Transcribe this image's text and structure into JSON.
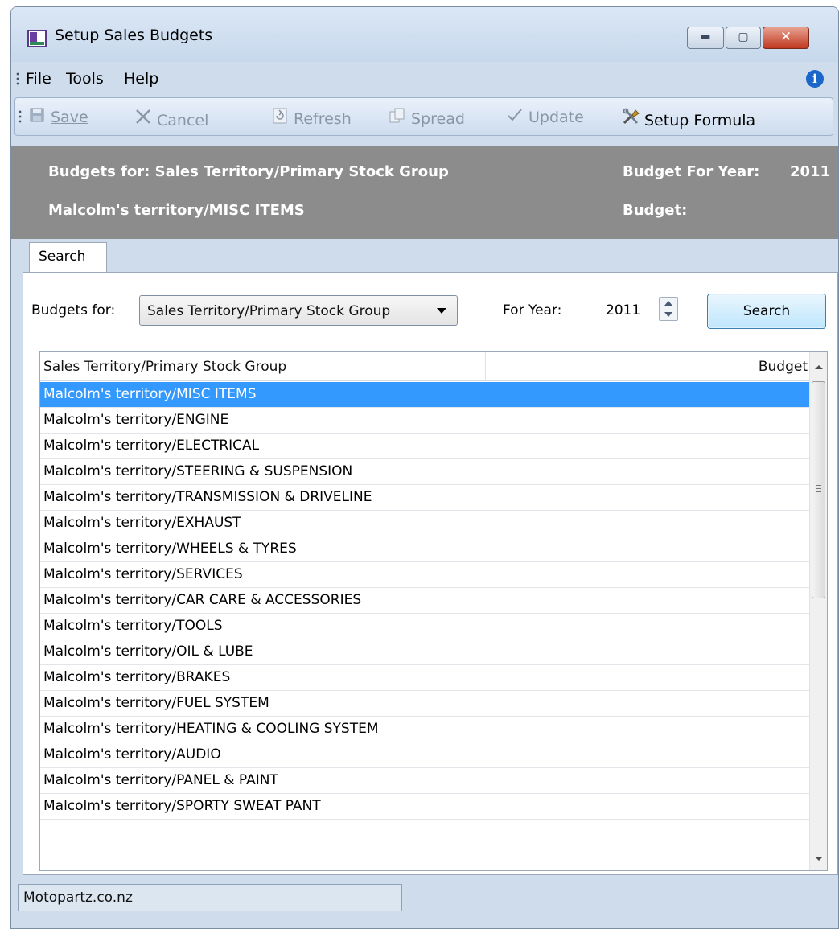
{
  "window": {
    "title": "Setup Sales Budgets",
    "minimize_label": "▬",
    "maximize_label": "▢",
    "close_label": "✕"
  },
  "menu": {
    "items": [
      {
        "label": "File"
      },
      {
        "label": "Tools"
      },
      {
        "label": "Help"
      }
    ],
    "info_glyph": "i"
  },
  "toolbar": {
    "save": {
      "label": "Save",
      "icon": "save-icon",
      "enabled": false
    },
    "cancel": {
      "label": "Cancel",
      "icon": "cancel-icon",
      "enabled": false
    },
    "refresh": {
      "label": "Refresh",
      "icon": "refresh-icon",
      "enabled": false
    },
    "spread": {
      "label": "Spread",
      "icon": "spread-icon",
      "enabled": false
    },
    "update": {
      "label": "Update",
      "icon": "checkmark-icon",
      "enabled": false
    },
    "setup_formula": {
      "label": "Setup Formula",
      "icon": "tools-icon",
      "enabled": true
    }
  },
  "header": {
    "budgets_for_label": "Budgets for:",
    "budgets_for_value": "Sales Territory/Primary Stock Group",
    "selected_item": "Malcolm's territory/MISC ITEMS",
    "budget_for_year_label": "Budget For Year:",
    "budget_for_year_value": "2011",
    "budget_label": "Budget:",
    "budget_value": ""
  },
  "tabs": [
    {
      "label": "Search",
      "active": true
    }
  ],
  "search": {
    "budgets_for_label": "Budgets for:",
    "budgets_for_selected": "Sales Territory/Primary Stock Group",
    "for_year_label": "For Year:",
    "for_year_value": "2011",
    "search_button": "Search"
  },
  "grid": {
    "columns": [
      "Sales Territory/Primary Stock Group",
      "Budget"
    ],
    "selected_index": 0,
    "rows": [
      "Malcolm's territory/MISC ITEMS",
      "Malcolm's territory/ENGINE",
      "Malcolm's territory/ELECTRICAL",
      "Malcolm's territory/STEERING & SUSPENSION",
      "Malcolm's territory/TRANSMISSION & DRIVELINE",
      "Malcolm's territory/EXHAUST",
      "Malcolm's territory/WHEELS & TYRES",
      "Malcolm's territory/SERVICES",
      "Malcolm's territory/CAR CARE & ACCESSORIES",
      "Malcolm's territory/TOOLS",
      "Malcolm's territory/OIL & LUBE",
      "Malcolm's territory/BRAKES",
      "Malcolm's territory/FUEL SYSTEM",
      "Malcolm's territory/HEATING & COOLING SYSTEM",
      "Malcolm's territory/AUDIO",
      "Malcolm's territory/PANEL & PAINT",
      "Malcolm's territory/SPORTY SWEAT PANT"
    ]
  },
  "status": {
    "company": "Motopartz.co.nz"
  },
  "colors": {
    "selection": "#3399ff",
    "header_band": "#8c8c8c",
    "window_frame": "#cfdcec",
    "close_button": "#c0391f"
  }
}
